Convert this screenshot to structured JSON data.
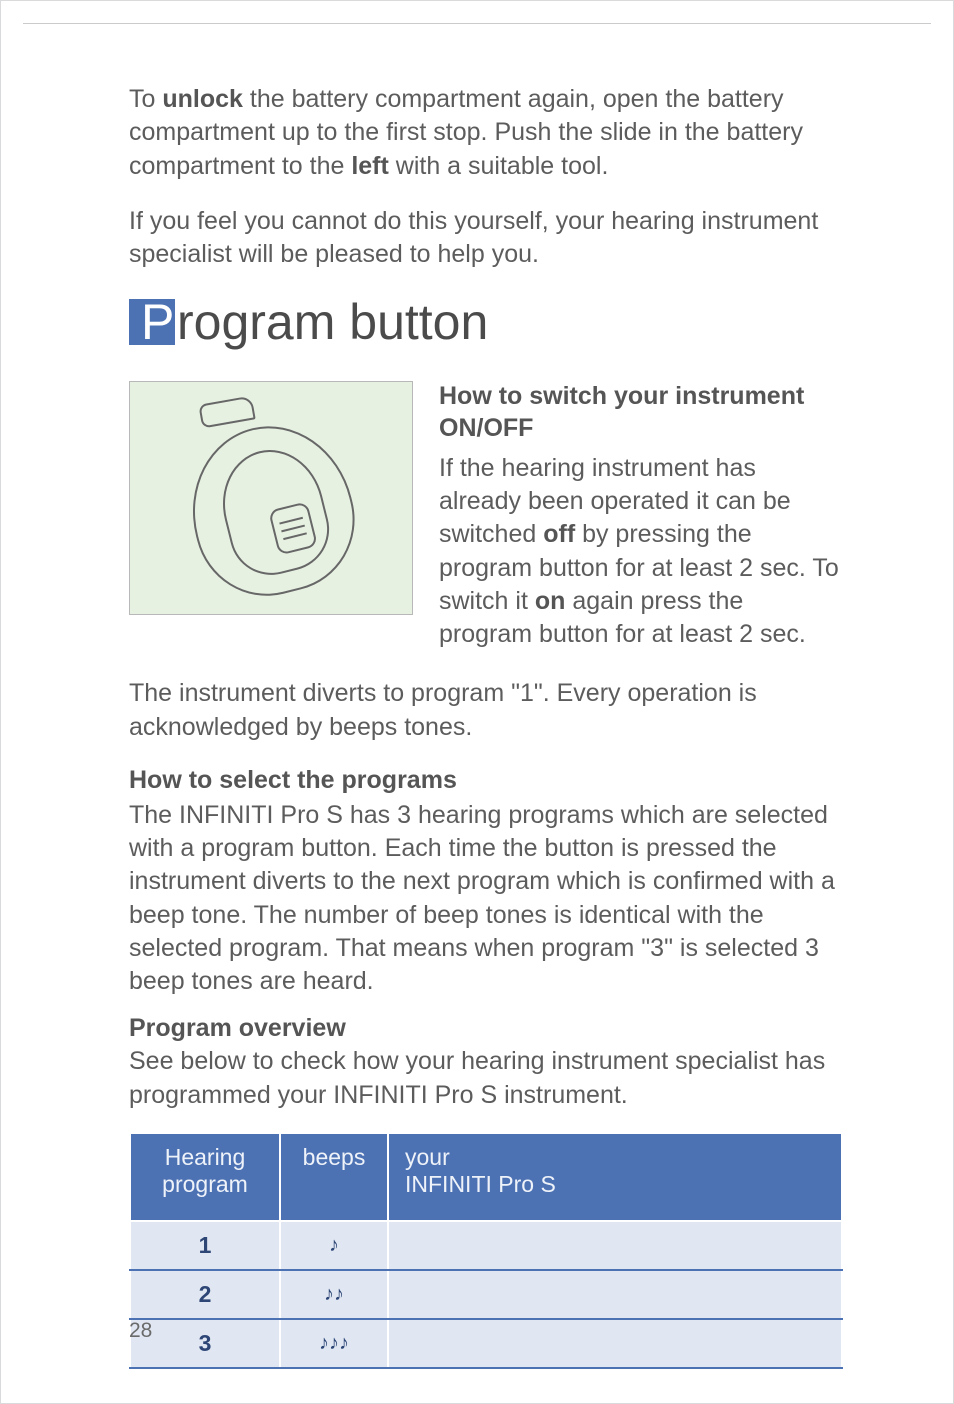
{
  "intro": {
    "para1_pre": "To ",
    "para1_b1": "unlock",
    "para1_mid": " the battery compartment again, open the battery compartment up to the first stop. Push the slide in the battery compartment to the ",
    "para1_b2": "left",
    "para1_post": " with a suitable tool.",
    "para2": "If you feel you cannot do this yourself, your hearing instrument specialist will be pleased to help you."
  },
  "heading": {
    "first": "P",
    "rest": "rogram button"
  },
  "onoff": {
    "title": "How to switch your instrument ON/OFF",
    "body_pre": "If the hearing instrument has already been operated it can be switched ",
    "b1": "off",
    "body_mid": " by pressing the program button for at least 2 sec. To switch it ",
    "b2": "on",
    "body_post": " again press the program button for at least 2 sec."
  },
  "divert": "The instrument diverts to program \"1\". Every operation is acknowledged by beeps tones.",
  "select": {
    "title": "How to select the programs",
    "body": "The INFINITI Pro S has 3 hearing programs which are selected with a program button. Each time the button is pressed the instrument diverts to the next program which is confirmed with a beep tone. The number of beep tones is identical with the selected program. That means when program \"3\" is selected 3 beep tones are heard."
  },
  "overview": {
    "title": "Program overview",
    "body": "See below to check how your hearing instrument specialist has programmed your INFINITI Pro S instrument."
  },
  "table": {
    "h1a": "Hearing",
    "h1b": "program",
    "h2": "beeps",
    "h3a": "your",
    "h3b": "INFINITI Pro S",
    "rows": [
      {
        "num": "1",
        "beeps": "♪",
        "val": ""
      },
      {
        "num": "2",
        "beeps": "♪♪",
        "val": ""
      },
      {
        "num": "3",
        "beeps": "♪♪♪",
        "val": ""
      }
    ]
  },
  "pagenum": "28"
}
